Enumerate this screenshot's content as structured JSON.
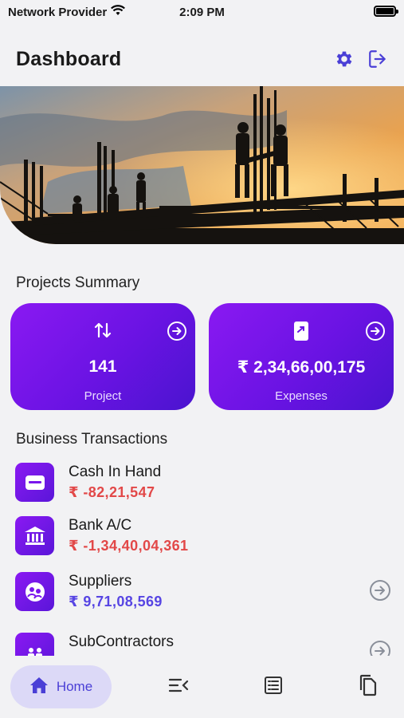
{
  "status_bar": {
    "carrier": "Network Provider",
    "time": "2:09 PM"
  },
  "header": {
    "title": "Dashboard"
  },
  "projects_summary": {
    "title": "Projects Summary",
    "cards": [
      {
        "value": "141",
        "label": "Project"
      },
      {
        "value": "₹ 2,34,66,00,175",
        "label": "Expenses"
      }
    ]
  },
  "business_transactions": {
    "title": "Business Transactions",
    "items": [
      {
        "name": "Cash In Hand",
        "amount": "₹ -82,21,547",
        "icon": "wallet-icon"
      },
      {
        "name": "Bank A/C",
        "amount": "₹ -1,34,40,04,361",
        "icon": "bank-icon"
      },
      {
        "name": "Suppliers",
        "amount": "₹ 9,71,08,569",
        "icon": "suppliers-icon"
      },
      {
        "name": "SubContractors",
        "amount": "",
        "icon": "subcontractors-icon"
      }
    ]
  },
  "tab_bar": {
    "home_label": "Home"
  },
  "colors": {
    "accent": "#4a3fd6",
    "card_gradient_start": "#8a19f2",
    "card_gradient_end": "#4a14cf",
    "negative": "#e24848",
    "positive": "#5745e3"
  }
}
